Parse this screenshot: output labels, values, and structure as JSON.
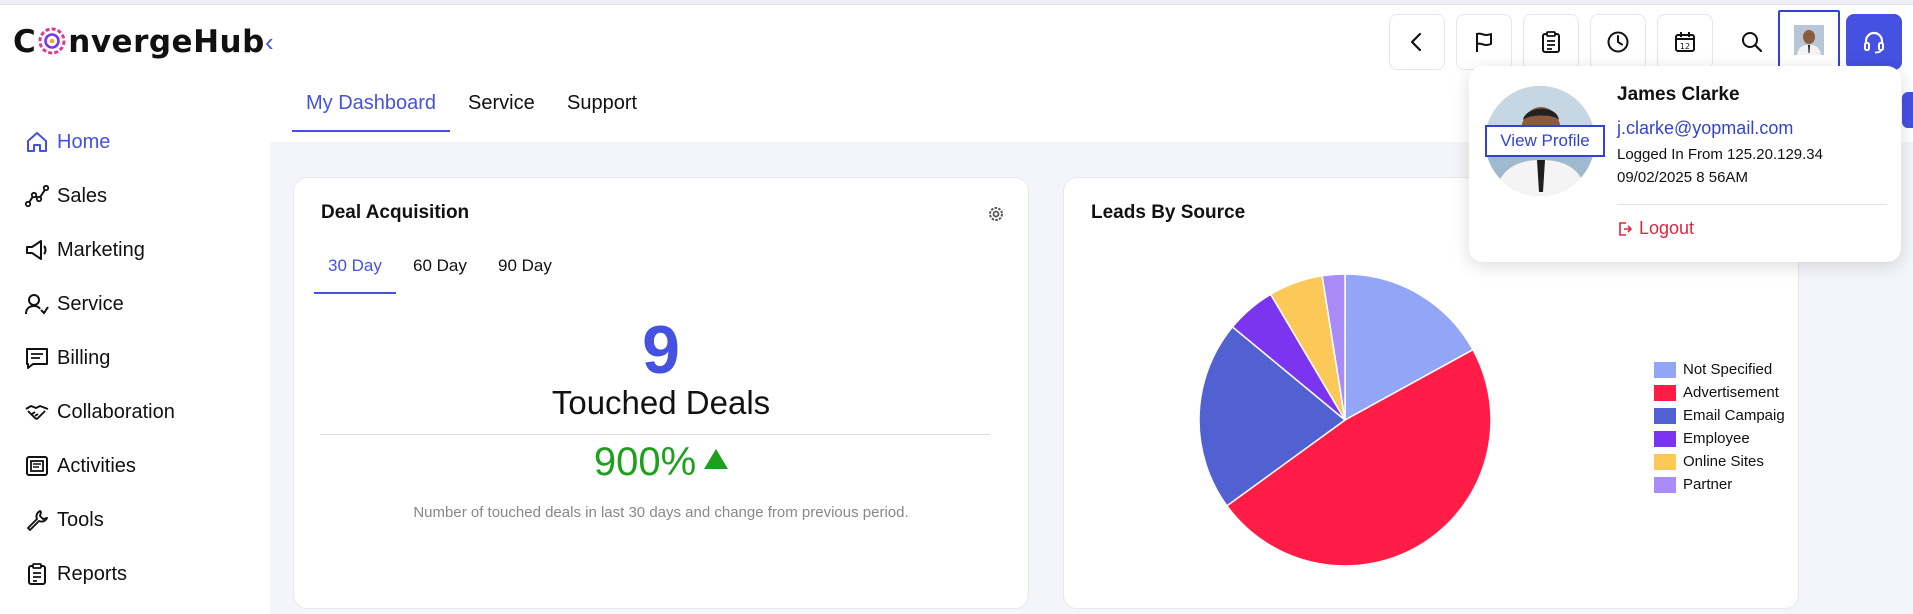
{
  "app": {
    "logo_prefix": "C",
    "logo_rest": "nvergeHub",
    "collapse_glyph": "‹"
  },
  "toolbar": {
    "buttons": [
      {
        "name": "back-icon"
      },
      {
        "name": "flag-icon"
      },
      {
        "name": "clipboard-icon"
      },
      {
        "name": "clock-icon"
      },
      {
        "name": "calendar-icon",
        "text": "12"
      },
      {
        "name": "search-icon"
      },
      {
        "name": "avatar"
      },
      {
        "name": "headset-icon"
      }
    ],
    "accent": "#4551e0"
  },
  "sidebar": {
    "items": [
      {
        "label": "Home",
        "icon": "home-icon",
        "active": true
      },
      {
        "label": "Sales",
        "icon": "sales-chart-icon"
      },
      {
        "label": "Marketing",
        "icon": "megaphone-icon"
      },
      {
        "label": "Service",
        "icon": "service-user-icon"
      },
      {
        "label": "Billing",
        "icon": "billing-icon"
      },
      {
        "label": "Collaboration",
        "icon": "handshake-icon"
      },
      {
        "label": "Activities",
        "icon": "activities-icon"
      },
      {
        "label": "Tools",
        "icon": "wrench-icon"
      },
      {
        "label": "Reports",
        "icon": "reports-icon"
      }
    ]
  },
  "tabs": [
    {
      "label": "My Dashboard",
      "active": true
    },
    {
      "label": "Service"
    },
    {
      "label": "Support"
    }
  ],
  "deal_card": {
    "title": "Deal Acquisition",
    "subtabs": [
      {
        "label": "30 Day",
        "active": true
      },
      {
        "label": "60 Day"
      },
      {
        "label": "90 Day"
      }
    ],
    "value": "9",
    "metric_label": "Touched Deals",
    "change": "900%",
    "note": "Number of touched deals in last 30 days and change from previous period."
  },
  "leads_card": {
    "title": "Leads By Source"
  },
  "chart_data": {
    "type": "pie",
    "title": "Leads By Source",
    "categories": [
      "Not Specified",
      "Advertisement",
      "Email Campaig",
      "Employee",
      "Online Sites",
      "Partner"
    ],
    "values": [
      17,
      48,
      21,
      5.5,
      6,
      2.5
    ],
    "colors": [
      "#93a5f7",
      "#ff1c46",
      "#5261d1",
      "#7b35f0",
      "#fcc857",
      "#a98cf7"
    ],
    "legend_position": "right"
  },
  "profile": {
    "name": "James Clarke",
    "email": "j.clarke@yopmail.com",
    "login_from": "Logged In From 125.20.129.34",
    "login_time": "09/02/2025 8  56AM",
    "view_profile": "View Profile",
    "logout": "Logout",
    "logout_color": "#e0253f"
  }
}
